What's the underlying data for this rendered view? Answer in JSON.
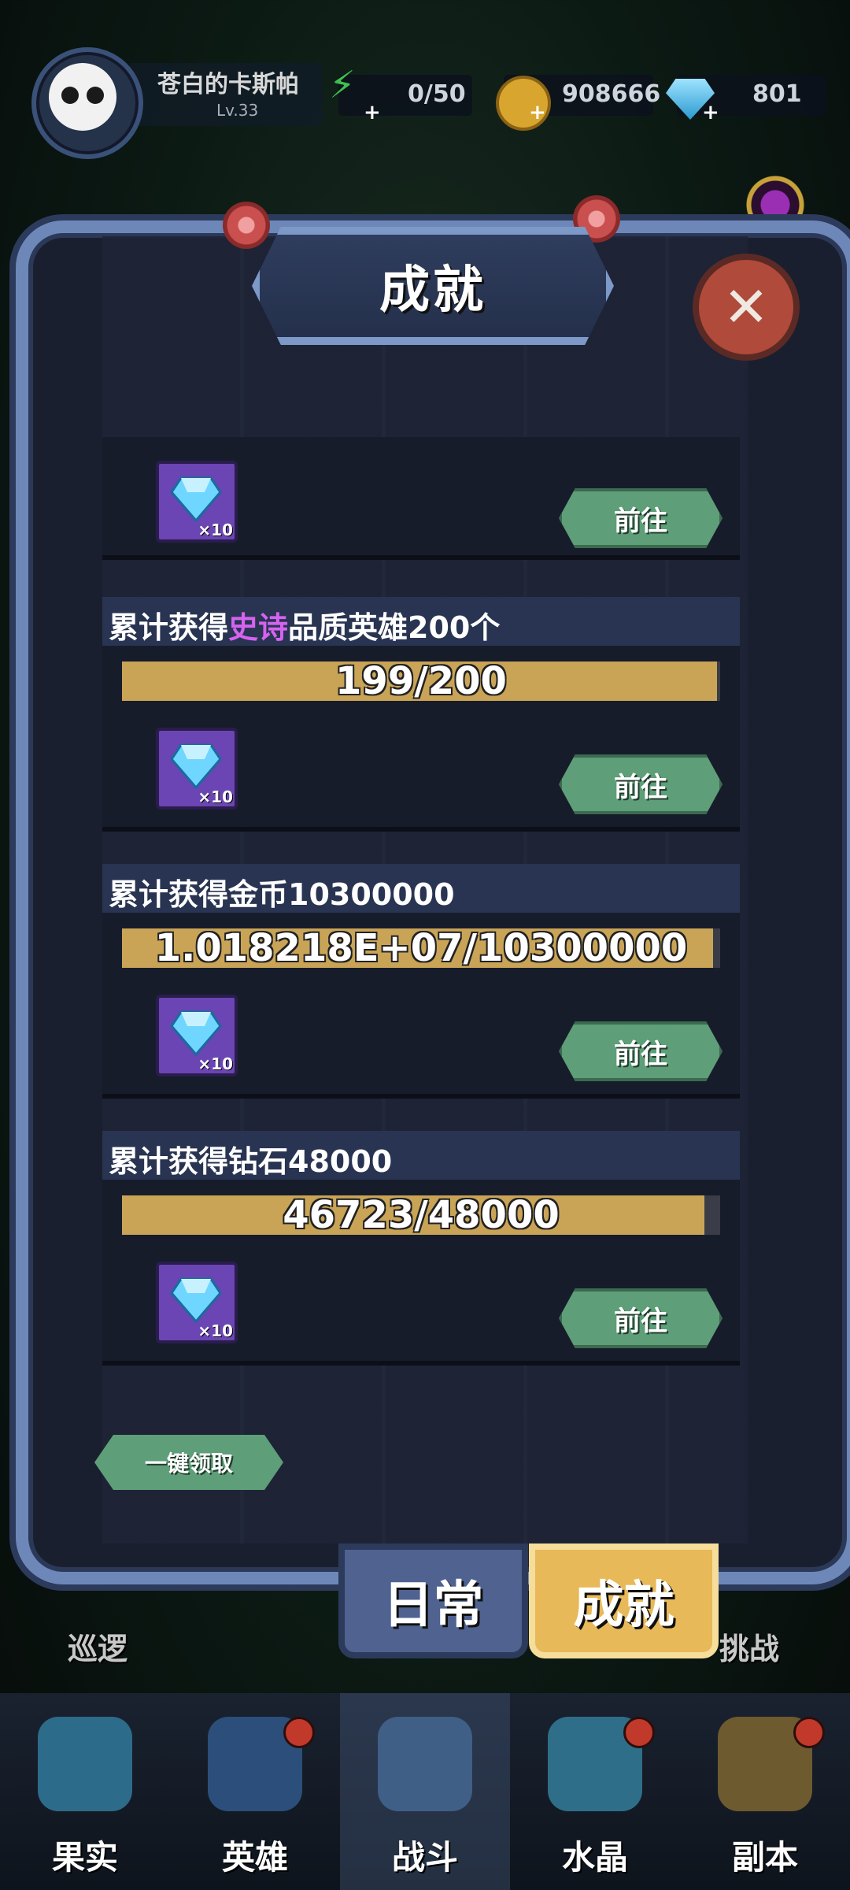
{
  "player": {
    "name": "苍白的卡斯帕",
    "level": "Lv.33"
  },
  "resources": {
    "energy": "0/50",
    "gold": "908666",
    "diamond": "801"
  },
  "modal": {
    "title": "成就",
    "close_icon": "close-icon",
    "achievements": [
      {
        "title_parts": [],
        "progress_text": "",
        "progress_fraction": 1.0,
        "reward_qty": "×10",
        "button": "前往"
      },
      {
        "title_parts": [
          "累计获得",
          "史诗",
          "品质英雄200个"
        ],
        "progress_text": "199/200",
        "progress_fraction": 0.995,
        "reward_qty": "×10",
        "button": "前往"
      },
      {
        "title_parts": [
          "累计获得金币10300000"
        ],
        "progress_text": "1.018218E+07/10300000",
        "progress_fraction": 0.9885,
        "reward_qty": "×10",
        "button": "前往"
      },
      {
        "title_parts": [
          "累计获得钻石48000"
        ],
        "progress_text": "46723/48000",
        "progress_fraction": 0.9734,
        "reward_qty": "×10",
        "button": "前往"
      }
    ],
    "collect_all": "一键领取",
    "tabs": {
      "daily": "日常",
      "achievement": "成就"
    }
  },
  "side_labels": {
    "left": "巡逻",
    "right": "挑战"
  },
  "bottom_nav": [
    "果实",
    "英雄",
    "战斗",
    "水晶",
    "副本"
  ],
  "colors": {
    "epic": "#d563f0",
    "progress": "#c9a457",
    "go_button": "#5e9e78"
  }
}
